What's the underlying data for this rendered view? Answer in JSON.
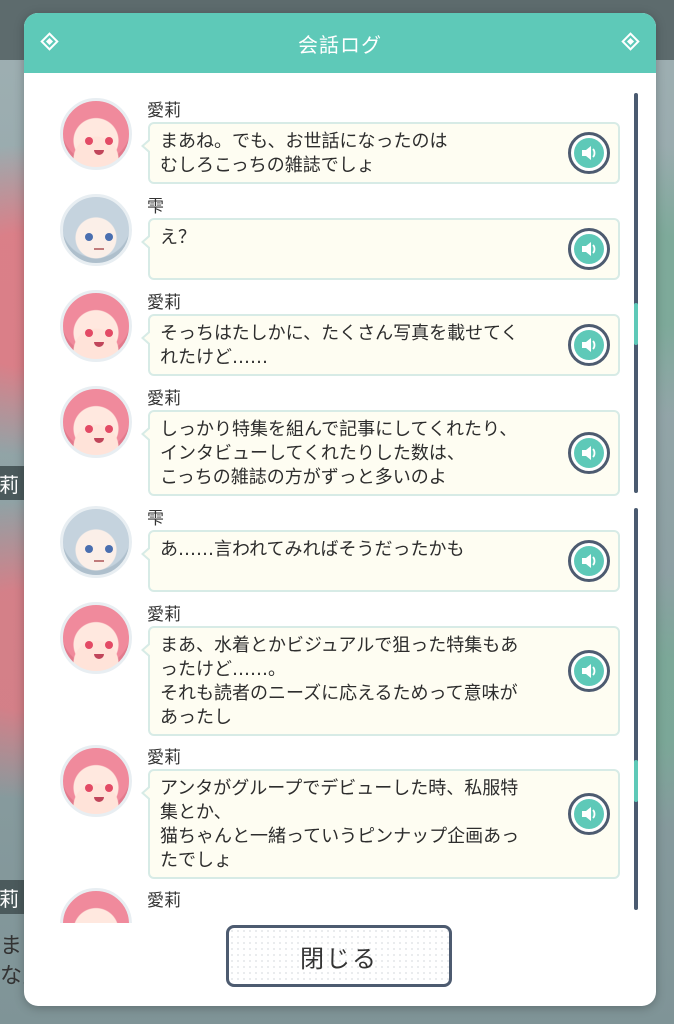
{
  "dialog": {
    "title": "会話ログ",
    "close_label": "閉じる"
  },
  "entries": [
    {
      "speaker": "愛莉",
      "text": "まあね。でも、お世話になったのは\nむしろこっちの雑誌でしょ",
      "icon": "airi"
    },
    {
      "speaker": "雫",
      "text": "え？",
      "icon": "shizuku"
    },
    {
      "speaker": "愛莉",
      "text": "そっちはたしかに、たくさん写真を載せてく\nれたけど……",
      "icon": "airi"
    },
    {
      "speaker": "愛莉",
      "text": "しっかり特集を組んで記事にしてくれたり、\nインタビューしてくれたりした数は、\nこっちの雑誌の方がずっと多いのよ",
      "icon": "airi"
    },
    {
      "speaker": "雫",
      "text": "あ……言われてみればそうだったかも",
      "icon": "shizuku"
    },
    {
      "speaker": "愛莉",
      "text": "まあ、水着とかビジュアルで狙った特集もあ\nったけど……。\nそれも読者のニーズに応えるためって意味が\nあったし",
      "icon": "airi"
    },
    {
      "speaker": "愛莉",
      "text": "アンタがグループでデビューした時、私服特\n集とか、\n猫ちゃんと一緒っていうピンナップ企画あっ\nたでしょ",
      "icon": "airi"
    },
    {
      "speaker": "愛莉",
      "text": "",
      "icon": "airi"
    }
  ],
  "background": {
    "name_tag": "莉",
    "name_tag_2": "莉",
    "text_1": "まら",
    "text_2": "なん"
  },
  "colors": {
    "header": "#5ec9b8",
    "bubble": "#fefdf2",
    "accent": "#4d5b70"
  },
  "icons": [
    "diamond-icon",
    "speaker-icon"
  ]
}
